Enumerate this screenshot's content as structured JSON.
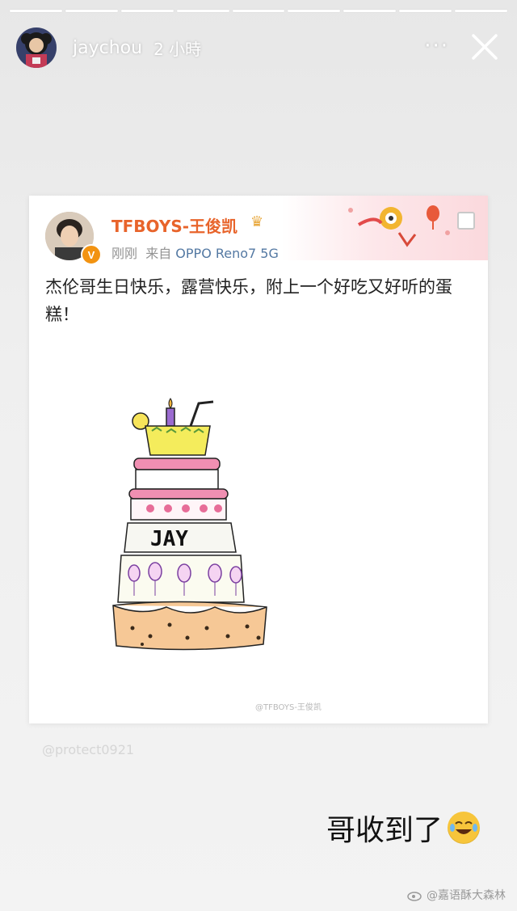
{
  "progress_segments": 9,
  "header": {
    "username": "jaychou",
    "timestamp": "2 小時",
    "more_label": "···",
    "avatar_icon": "user-avatar",
    "close_icon": "close-icon"
  },
  "post": {
    "author": "TFBOYS-王俊凯",
    "crown_icon": "crown-icon",
    "verified_badge": "V",
    "time": "刚刚",
    "from_label": "来自",
    "source": "OPPO Reno7 5G",
    "text": "杰伦哥生日快乐，露营快乐，附上一个好吃又好听的蛋糕！",
    "image_watermark": "@TFBOYS-王俊凯",
    "cake_text": "JAY"
  },
  "overlay": {
    "handle": "@protect0921",
    "reply_text": "哥收到了",
    "reply_emoji": "laughing-with-tears-emoji"
  },
  "footer": {
    "watermark": "@嘉语酥大森林"
  },
  "colors": {
    "author_name": "#e8642b",
    "source": "#5479a3",
    "verified": "#f29311"
  }
}
